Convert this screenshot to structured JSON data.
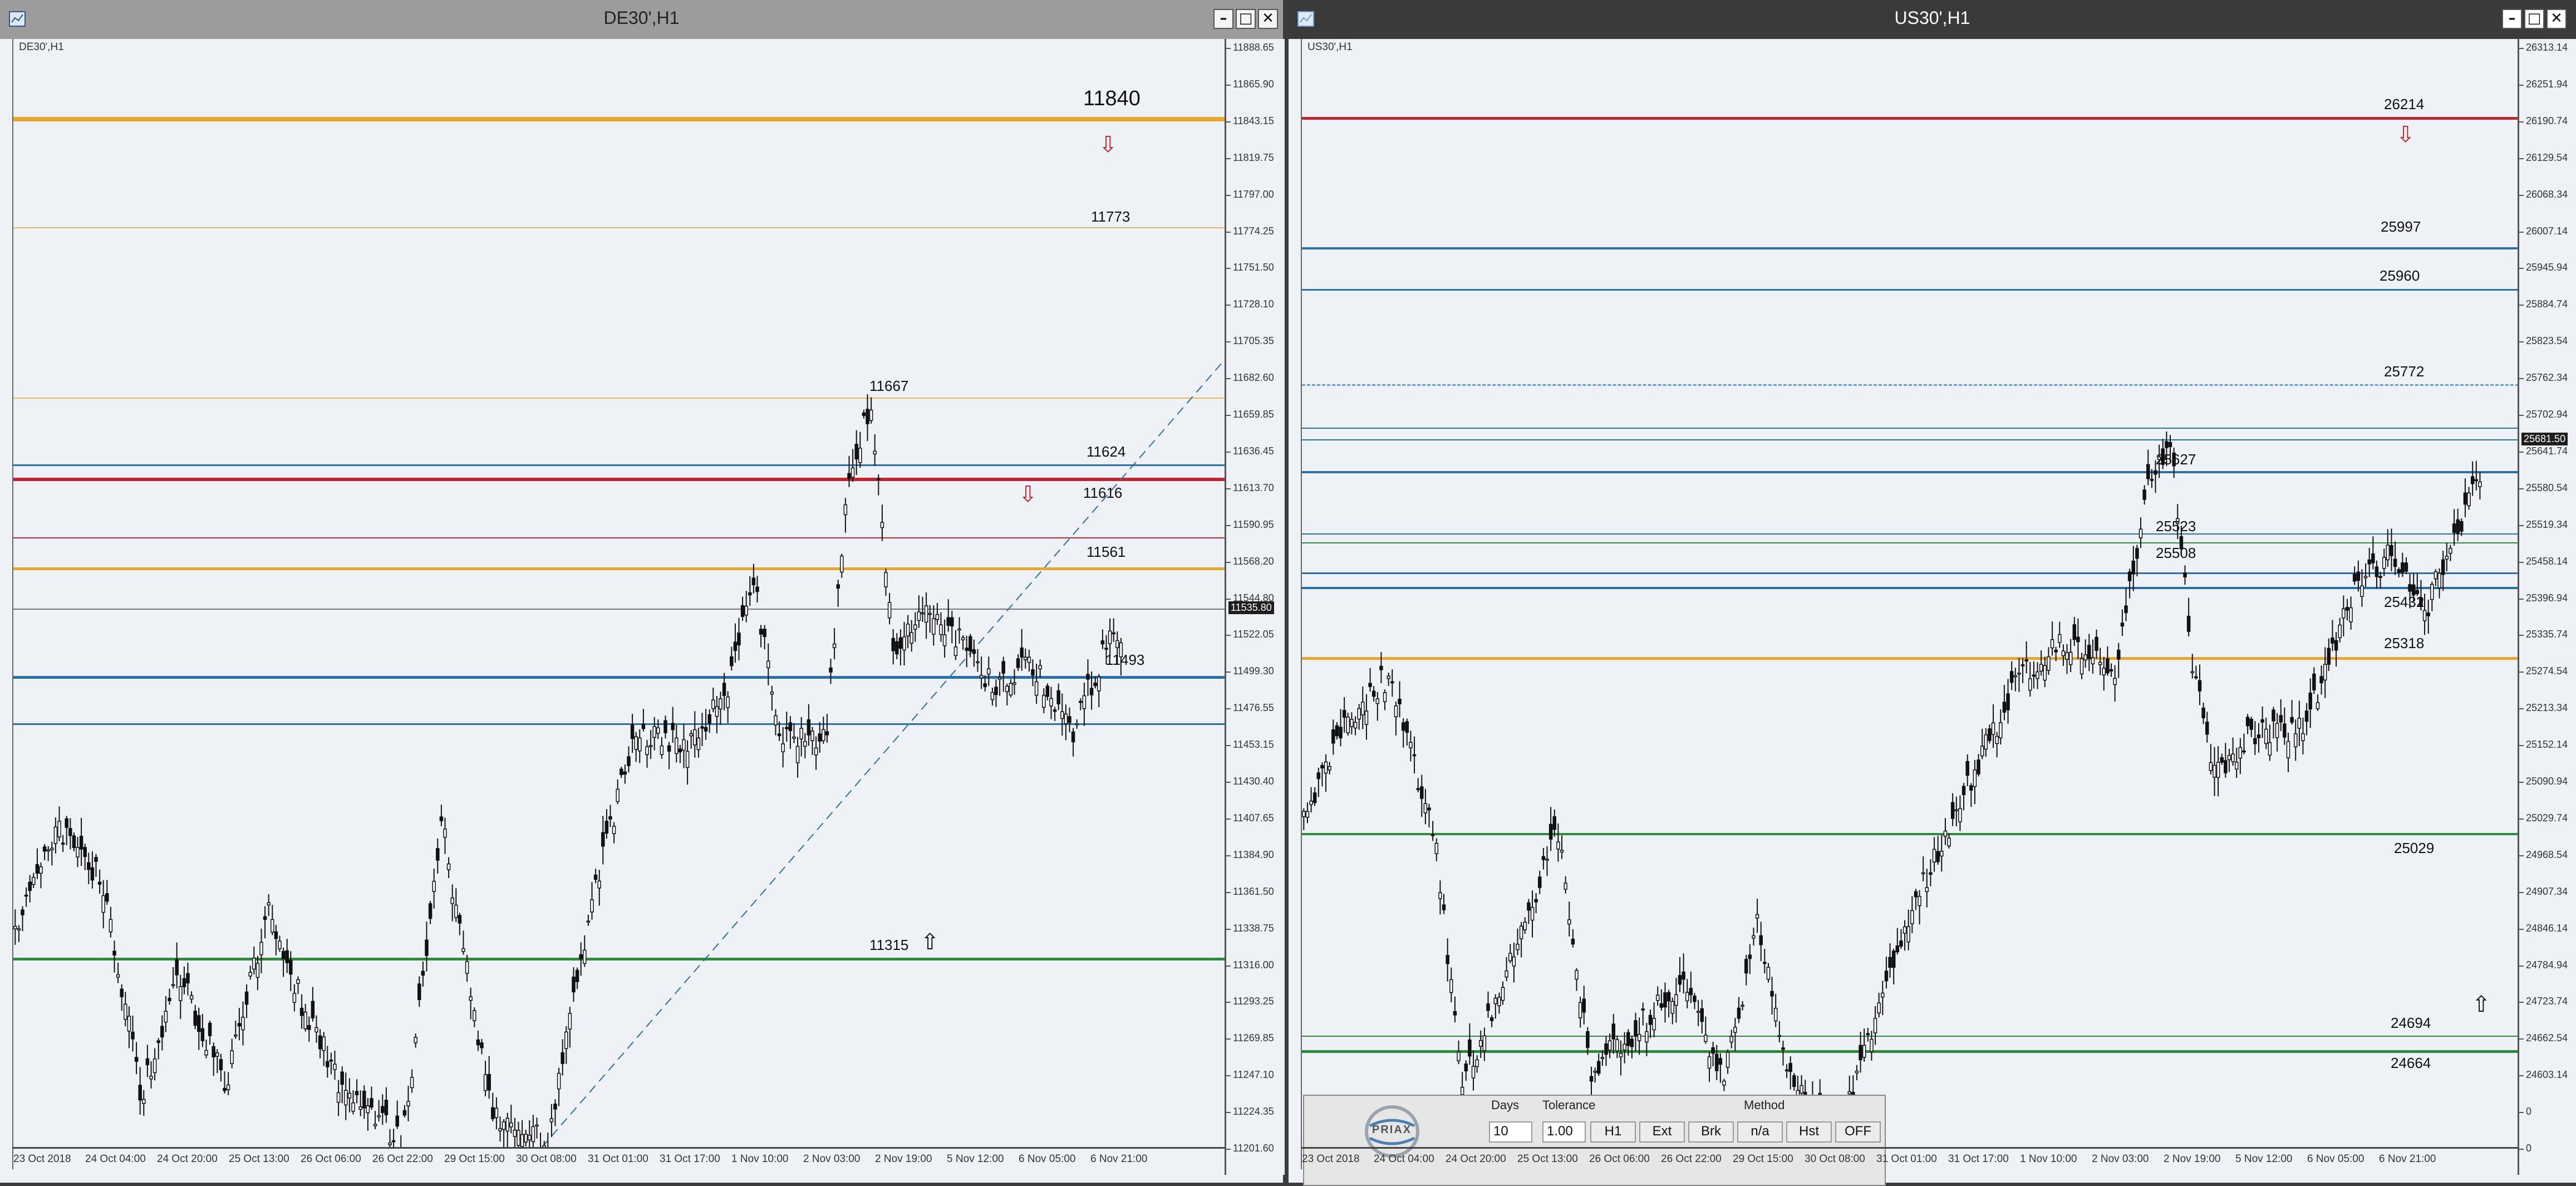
{
  "left": {
    "title": "DE30',H1",
    "symbol": "DE30',H1",
    "price_labels": [
      "11888.65",
      "11865.90",
      "11843.15",
      "11819.75",
      "11797.00",
      "11774.25",
      "11751.50",
      "11728.10",
      "11705.35",
      "11682.60",
      "11659.85",
      "11636.45",
      "11613.70",
      "11590.95",
      "11568.20",
      "11544.80",
      "11522.05",
      "11499.30",
      "11476.55",
      "11453.15",
      "11430.40",
      "11407.65",
      "11384.90",
      "11361.50",
      "11338.75",
      "11316.00",
      "11293.25",
      "11269.85",
      "11247.10",
      "11224.35",
      "11201.60"
    ],
    "current_price": "11535.80",
    "dates": [
      "23 Oct 2018",
      "24 Oct 04:00",
      "24 Oct 20:00",
      "25 Oct 13:00",
      "26 Oct 06:00",
      "26 Oct 22:00",
      "29 Oct 15:00",
      "30 Oct 08:00",
      "31 Oct 01:00",
      "31 Oct 17:00",
      "1 Nov 10:00",
      "2 Nov 03:00",
      "2 Nov 19:00",
      "5 Nov 12:00",
      "6 Nov 05:00",
      "6 Nov 21:00"
    ],
    "levels": [
      "11840",
      "11773",
      "11667",
      "11624",
      "11616",
      "11561",
      "11493",
      "11315"
    ]
  },
  "right": {
    "title": "US30',H1",
    "symbol": "US30',H1",
    "price_labels": [
      "26313.14",
      "26251.94",
      "26190.74",
      "26129.54",
      "26068.34",
      "26007.14",
      "25945.94",
      "25884.74",
      "25823.54",
      "25762.34",
      "25702.94",
      "25641.74",
      "25580.54",
      "25519.34",
      "25458.14",
      "25396.94",
      "25335.74",
      "25274.54",
      "25213.34",
      "25152.14",
      "25090.94",
      "25029.74",
      "24968.54",
      "24907.34",
      "24846.14",
      "24784.94",
      "24723.74",
      "24662.54",
      "24603.14",
      "0",
      "0"
    ],
    "current_price": "25681.50",
    "dates": [
      "23 Oct 2018",
      "24 Oct 04:00",
      "24 Oct 20:00",
      "25 Oct 13:00",
      "26 Oct 06:00",
      "26 Oct 22:00",
      "29 Oct 15:00",
      "30 Oct 08:00",
      "31 Oct 01:00",
      "31 Oct 17:00",
      "1 Nov 10:00",
      "2 Nov 03:00",
      "2 Nov 19:00",
      "5 Nov 12:00",
      "6 Nov 05:00",
      "6 Nov 21:00"
    ],
    "levels": [
      "26214",
      "25997",
      "25960",
      "25772",
      "25627",
      "25523",
      "25508",
      "25432",
      "25318",
      "25029",
      "24694",
      "24664"
    ],
    "panel": {
      "logo": "PRIAX",
      "days_label": "Days",
      "tolerance_label": "Tolerance",
      "method_label": "Method",
      "days_value": "10",
      "tolerance_value": "1.00",
      "buttons": [
        "H1",
        "Ext",
        "Brk",
        "n/a",
        "Hst",
        "OFF"
      ]
    }
  },
  "colors": {
    "resistance_red": "#c0262d",
    "pivot_orange": "#e8a62c",
    "blue_level": "#2b6fa8",
    "support_green": "#2e8b3e",
    "background": "#eef2f6"
  }
}
